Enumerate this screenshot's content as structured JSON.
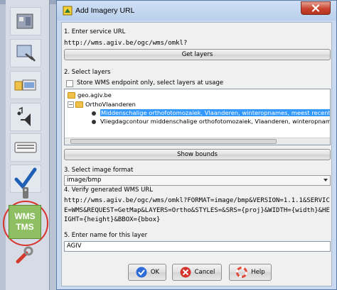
{
  "dialog": {
    "title": "Add Imagery URL"
  },
  "step1": {
    "label": "1. Enter service URL",
    "url": "http://wms.agiv.be/ogc/wms/omkl?",
    "button": "Get layers"
  },
  "step2": {
    "label": "2. Select layers",
    "store_checkbox_label": "Store WMS endpoint only, select layers at usage",
    "tree": {
      "root": "geo.agiv.be",
      "group": "OrthoVlaanderen",
      "layers": [
        "Middenschalige orthofotomozaiek, Vlaanderen, winteropnames, meest recent",
        "Vliegdagcontour middenschalige orthofotomozaiek, Vlaanderen, winteropnames, mee"
      ]
    },
    "button": "Show bounds"
  },
  "step3": {
    "label": "3. Select image format",
    "value": "image/bmp"
  },
  "step4": {
    "label": "4. Verify generated WMS URL",
    "url": "http://wms.agiv.be/ogc/wms/omkl?FORMAT=image/bmp&VERSION=1.1.1&SERVICE=WMS&REQUEST=GetMap&LAYERS=Ortho&STYLES=&SRS={proj}&WIDTH={width}&HEIGHT={height}&BBOX={bbox}"
  },
  "step5": {
    "label": "5. Enter name for this layer",
    "value": "AGIV"
  },
  "buttons": {
    "ok": "OK",
    "cancel": "Cancel",
    "help": "Help"
  },
  "sidebar": {
    "wms_label_top": "WMS",
    "wms_label_bottom": "TMS"
  },
  "colors": {
    "selection": "#3399ff",
    "highlight_ring": "#d9332b",
    "wms_tile": "#8fbf63"
  }
}
